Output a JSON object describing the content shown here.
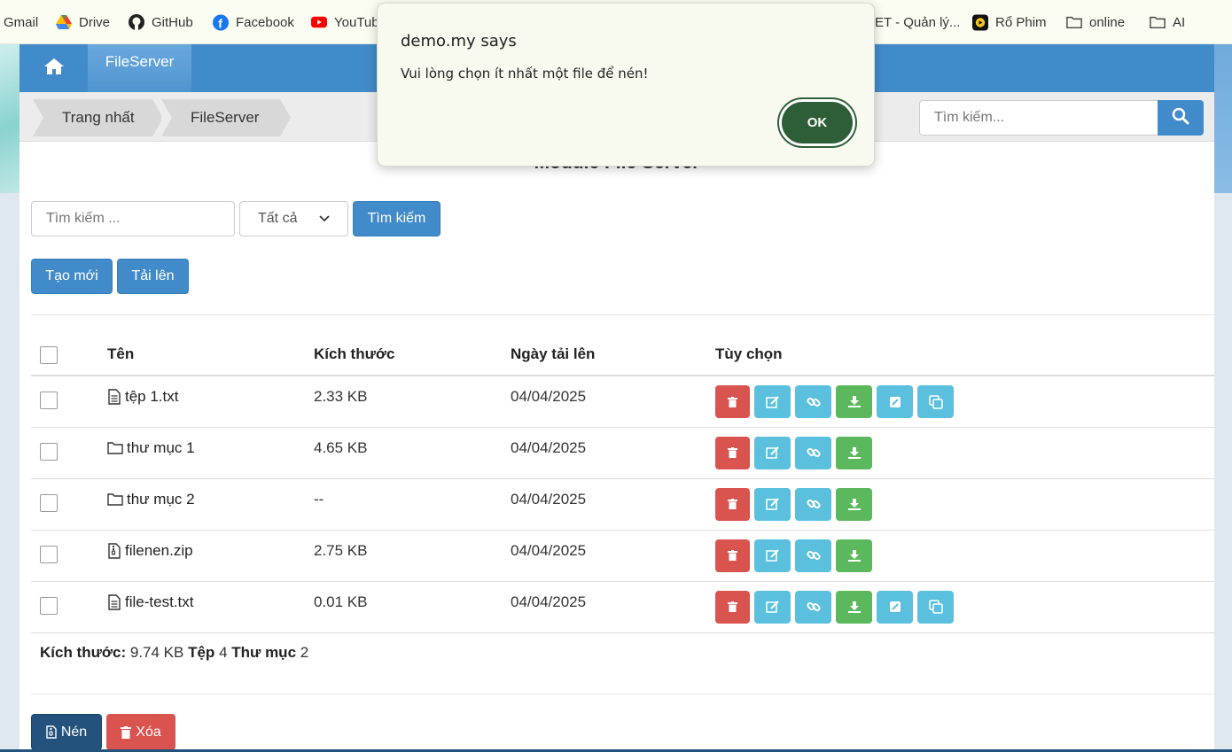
{
  "bookmarks": [
    {
      "label": "Gmail",
      "icon": "gmail-icon"
    },
    {
      "label": "Drive",
      "icon": "drive-icon"
    },
    {
      "label": "GitHub",
      "icon": "github-icon"
    },
    {
      "label": "Facebook",
      "icon": "facebook-icon"
    },
    {
      "label": "YouTub",
      "icon": "youtube-icon"
    },
    {
      "label": "ET - Quản lý...",
      "icon": ""
    },
    {
      "label": "Rổ Phim",
      "icon": "rophim-icon"
    },
    {
      "label": "online",
      "icon": "folder-icon"
    },
    {
      "label": "AI",
      "icon": "folder-icon"
    }
  ],
  "nav": {
    "active": "FileServer"
  },
  "breadcrumb": [
    "Trang nhất",
    "FileServer"
  ],
  "top_search": {
    "placeholder": "Tìm kiếm..."
  },
  "module_title": "Module File Server",
  "filter": {
    "placeholder": "Tìm kiếm ...",
    "select_value": "Tất cả",
    "search_label": "Tìm kiếm"
  },
  "actions": {
    "create": "Tạo mới",
    "upload": "Tải lên"
  },
  "table": {
    "headers": [
      "Tên",
      "Kích thước",
      "Ngày tải lên",
      "Tùy chọn"
    ],
    "rows": [
      {
        "name": "tệp 1.txt",
        "type": "file",
        "size": "2.33 KB",
        "date": "04/04/2025"
      },
      {
        "name": "thư mục 1",
        "type": "folder",
        "size": "4.65 KB",
        "date": "04/04/2025"
      },
      {
        "name": "thư mục 2",
        "type": "folder",
        "size": "--",
        "date": "04/04/2025"
      },
      {
        "name": "filenen.zip",
        "type": "zip",
        "size": "2.75 KB",
        "date": "04/04/2025"
      },
      {
        "name": "file-test.txt",
        "type": "file",
        "size": "0.01 KB",
        "date": "04/04/2025"
      }
    ]
  },
  "summary": {
    "size_label": "Kích thước:",
    "size_value": "9.74 KB",
    "files_label": "Tệp",
    "files_value": "4",
    "folders_label": "Thư mục",
    "folders_value": "2"
  },
  "bottom": {
    "compress": "Nén",
    "delete": "Xóa"
  },
  "dialog": {
    "title": "demo.my says",
    "message": "Vui lòng chọn ít nhất một file để nén!",
    "ok": "OK"
  },
  "colors": {
    "primary": "#428bca",
    "danger": "#d9534f",
    "info": "#5bc0de",
    "success": "#5cb85c",
    "dialog_ok": "#2e5e38"
  }
}
